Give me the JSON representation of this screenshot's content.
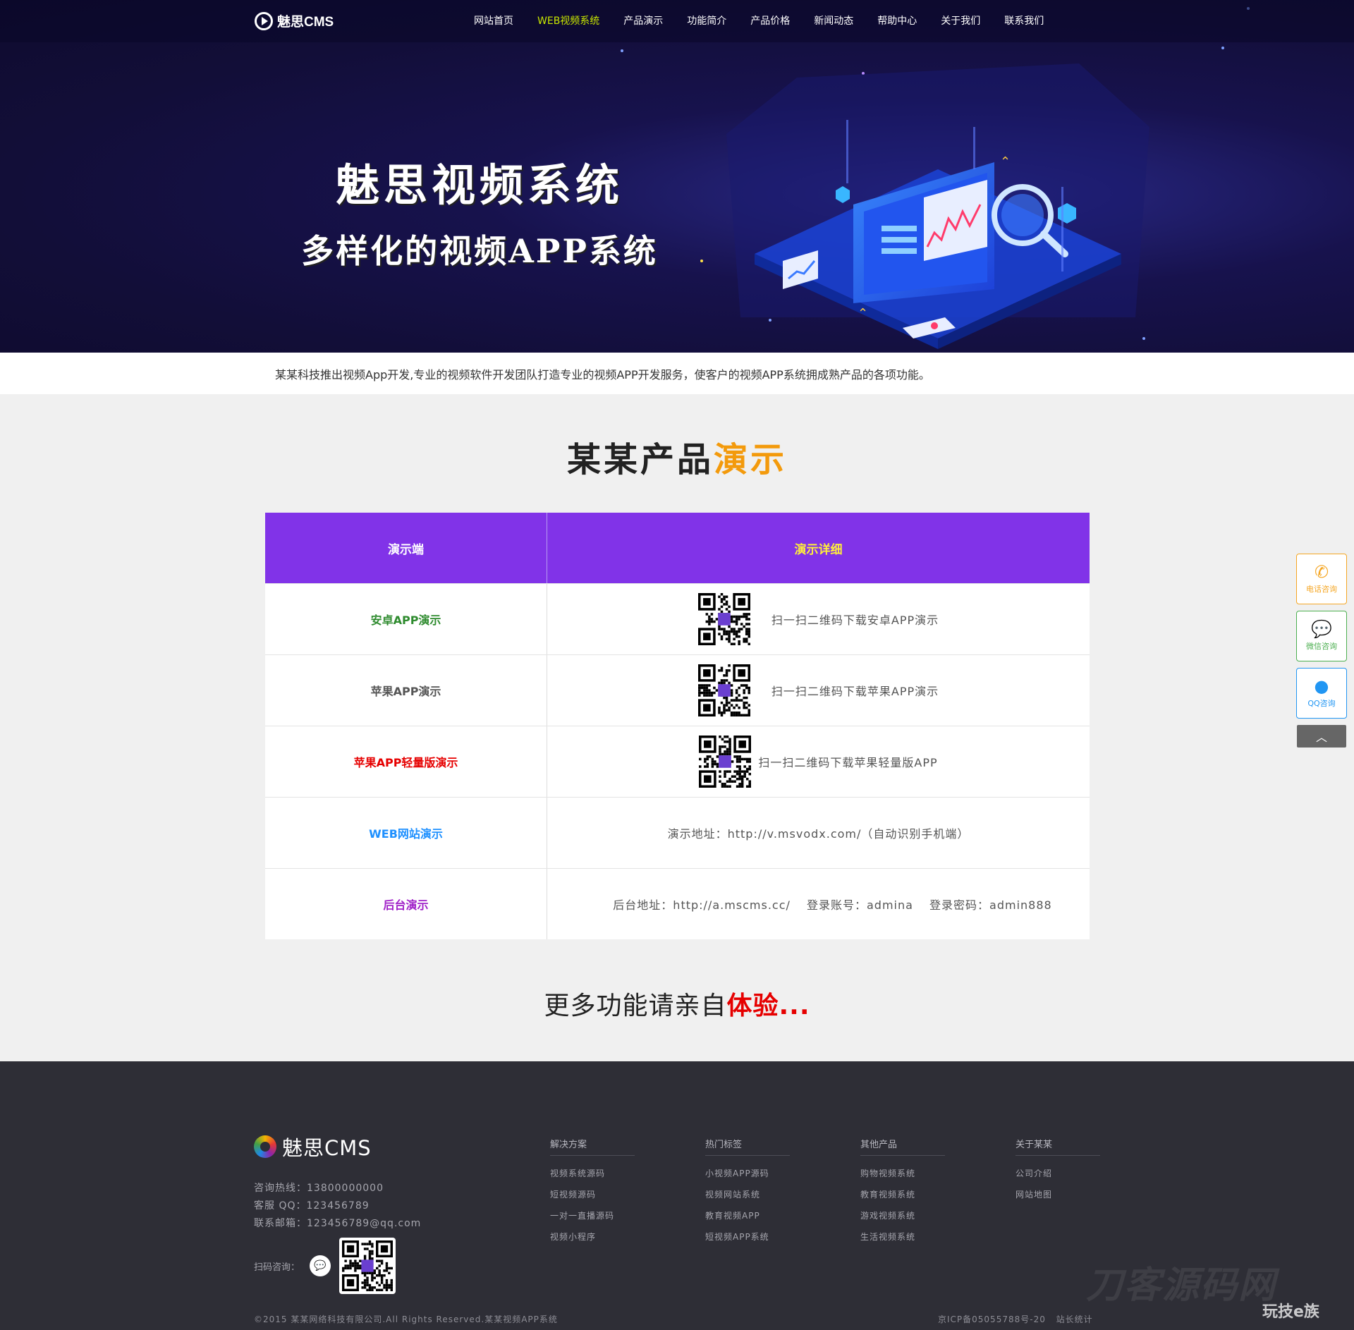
{
  "header": {
    "logo_text": "魅思CMS",
    "menu": [
      {
        "label": "网站首页",
        "active": false
      },
      {
        "label": "WEB视频系统",
        "active": true
      },
      {
        "label": "产品演示",
        "active": false
      },
      {
        "label": "功能简介",
        "active": false
      },
      {
        "label": "产品价格",
        "active": false
      },
      {
        "label": "新闻动态",
        "active": false
      },
      {
        "label": "帮助中心",
        "active": false
      },
      {
        "label": "关于我们",
        "active": false
      },
      {
        "label": "联系我们",
        "active": false
      }
    ]
  },
  "hero": {
    "title": "魅思视频系统",
    "subtitle": "多样化的视频APP系统"
  },
  "intro": "某某科技推出视频App开发,专业的视频软件开发团队打造专业的视频APP开发服务，使客户的视频APP系统拥成熟产品的各项功能。",
  "section": {
    "title_main": "某某产品",
    "title_highlight": "演示"
  },
  "demo_table": {
    "headers": [
      "演示端",
      "演示详细"
    ],
    "rows": [
      {
        "name": "安卓APP演示",
        "color": "#2e8b2e",
        "detail": "扫一扫二维码下载安卓APP演示",
        "has_qr": true
      },
      {
        "name": "苹果APP演示",
        "color": "#555555",
        "detail": "扫一扫二维码下载苹果APP演示",
        "has_qr": true
      },
      {
        "name": "苹果APP轻量版演示",
        "color": "#e60000",
        "detail": "扫一扫二维码下载苹果轻量版APP",
        "has_qr": true
      },
      {
        "name": "WEB网站演示",
        "color": "#1e90ff",
        "detail": "演示地址：http://v.msvodx.com/（自动识别手机端）",
        "has_qr": false
      },
      {
        "name": "后台演示",
        "color": "#a020c8",
        "detail": "后台地址：http://a.mscms.cc/　 登录账号：admina　 登录密码：admin888",
        "has_qr": false
      }
    ]
  },
  "more": {
    "text": "更多功能请亲自",
    "highlight": "体验..."
  },
  "footer": {
    "logo_text": "魅思CMS",
    "contact": [
      "咨询热线：13800000000",
      "客服 QQ：123456789",
      "联系邮箱：123456789@qq.com"
    ],
    "scan_label": "扫码咨询：",
    "columns": [
      {
        "title": "解决方案",
        "links": [
          "视频系统源码",
          "短视频源码",
          "一对一直播源码",
          "视频小程序"
        ]
      },
      {
        "title": "热门标签",
        "links": [
          "小视频APP源码",
          "视频网站系统",
          "教育视频APP",
          "短视频APP系统"
        ]
      },
      {
        "title": "其他产品",
        "links": [
          "购物视频系统",
          "教育视频系统",
          "游戏视频系统",
          "生活视频系统"
        ]
      },
      {
        "title": "关于某某",
        "links": [
          "公司介绍",
          "网站地图"
        ]
      }
    ],
    "copyright": "©2015 某某网络科技有限公司.All Rights Reserved.某某视频APP系统",
    "icp": "京ICP备05055788号-20",
    "stats": "站长统计"
  },
  "side_float": {
    "tel": "电话咨询",
    "wechat": "微信咨询",
    "qq": "QQ咨询"
  },
  "watermark": {
    "main": "刀客源码网",
    "corner": "玩技e族"
  },
  "colors": {
    "nav_active": "#c8e600",
    "table_header": "#8133e8",
    "section_highlight": "#f39a0c",
    "footer_bg": "#2e2e36"
  }
}
